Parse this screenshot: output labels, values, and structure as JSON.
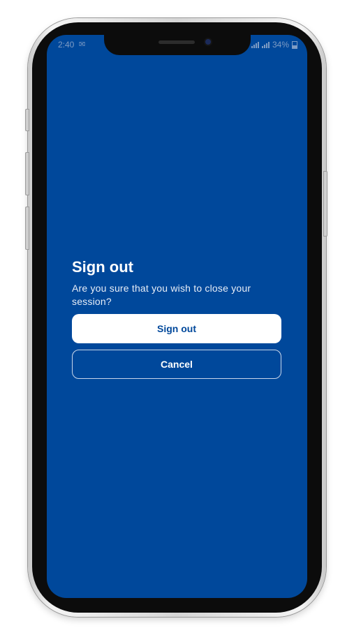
{
  "status_bar": {
    "time": "2:40",
    "battery": "34%"
  },
  "dialog": {
    "title": "Sign out",
    "message": "Are you sure that you wish to close your session?",
    "confirm_label": "Sign out",
    "cancel_label": "Cancel"
  },
  "colors": {
    "background": "#00489b",
    "primary_button_bg": "#ffffff",
    "primary_button_text": "#00489b",
    "text": "#ffffff"
  },
  "icons": [
    "mail-icon",
    "signal-icon",
    "battery-icon"
  ]
}
